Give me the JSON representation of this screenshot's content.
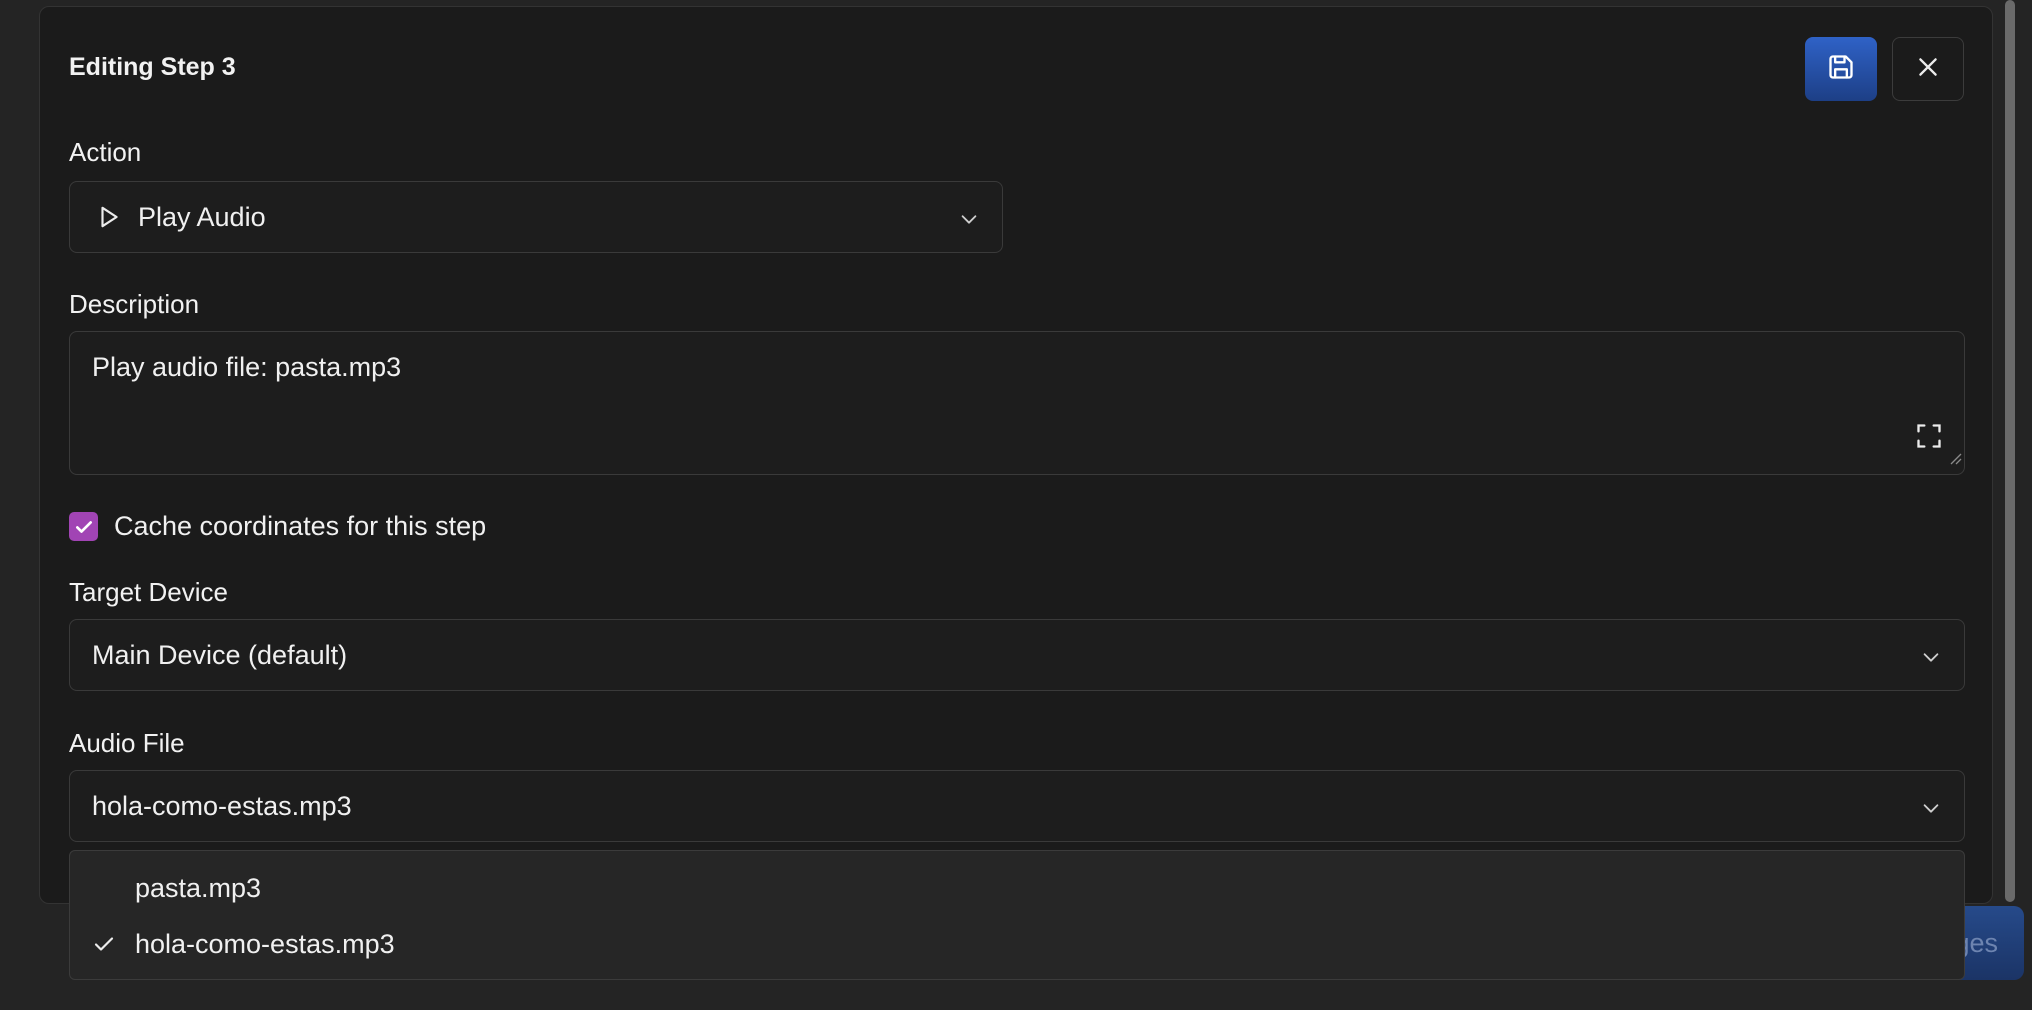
{
  "backdrop": {
    "button_fragment": "ges"
  },
  "modal": {
    "title": "Editing Step 3",
    "save_icon": "floppy-disk-icon",
    "close_icon": "close-icon",
    "accent_color": "#2f62c7",
    "checkbox_color": "#a144b4"
  },
  "action": {
    "label": "Action",
    "selected": "Play Audio",
    "icon": "play-icon"
  },
  "description": {
    "label": "Description",
    "value": "Play audio file: pasta.mp3"
  },
  "cache": {
    "label": "Cache coordinates for this step",
    "checked": true
  },
  "target_device": {
    "label": "Target Device",
    "selected": "Main Device (default)"
  },
  "audio_file": {
    "label": "Audio File",
    "selected": "hola-como-estas.mp3",
    "options": [
      {
        "label": "pasta.mp3",
        "selected": false
      },
      {
        "label": "hola-como-estas.mp3",
        "selected": true
      }
    ]
  }
}
